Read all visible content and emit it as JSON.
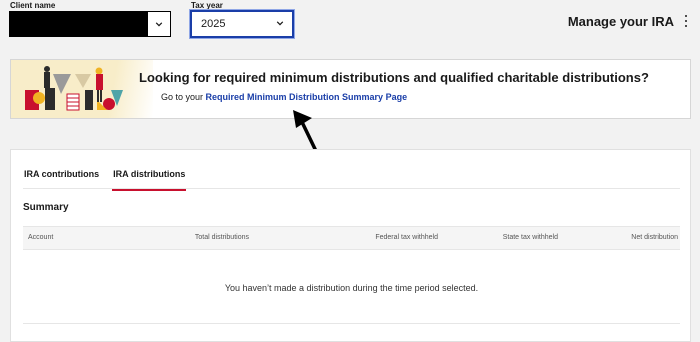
{
  "header": {
    "client_name_label": "Client name",
    "tax_year_label": "Tax year",
    "tax_year_value": "2025",
    "title": "Manage your IRA",
    "accent_color": "#1a3ea8"
  },
  "banner": {
    "title": "Looking for required minimum distributions and qualified charitable distributions?",
    "prefix": "Go to your",
    "link_text": "Required Minimum Distribution Summary Page"
  },
  "tabs": [
    {
      "label": "IRA contributions",
      "active": false
    },
    {
      "label": "IRA distributions",
      "active": true
    }
  ],
  "summary": {
    "heading": "Summary",
    "columns": [
      "Account",
      "Total distributions",
      "Federal tax withheld",
      "State tax withheld",
      "Net distribution"
    ],
    "empty_message": "You haven’t made a distribution during the time period selected."
  },
  "icons": {
    "client_caret": "chevron-down-icon",
    "year_caret": "chevron-down-icon",
    "menu": "kebab-menu-icon"
  }
}
